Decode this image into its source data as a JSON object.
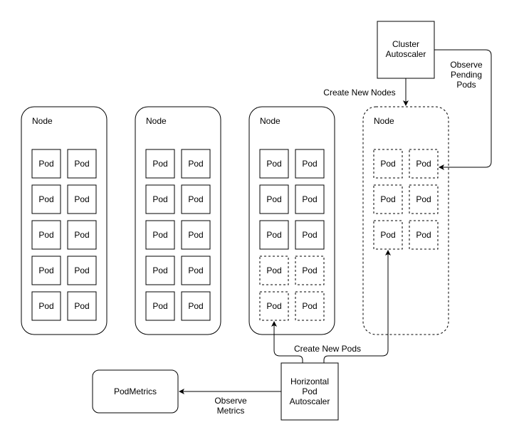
{
  "nodes": [
    {
      "label": "Node",
      "style": "solid",
      "pods": [
        {
          "label": "Pod",
          "style": "solid"
        },
        {
          "label": "Pod",
          "style": "solid"
        },
        {
          "label": "Pod",
          "style": "solid"
        },
        {
          "label": "Pod",
          "style": "solid"
        },
        {
          "label": "Pod",
          "style": "solid"
        },
        {
          "label": "Pod",
          "style": "solid"
        },
        {
          "label": "Pod",
          "style": "solid"
        },
        {
          "label": "Pod",
          "style": "solid"
        },
        {
          "label": "Pod",
          "style": "solid"
        },
        {
          "label": "Pod",
          "style": "solid"
        }
      ]
    },
    {
      "label": "Node",
      "style": "solid",
      "pods": [
        {
          "label": "Pod",
          "style": "solid"
        },
        {
          "label": "Pod",
          "style": "solid"
        },
        {
          "label": "Pod",
          "style": "solid"
        },
        {
          "label": "Pod",
          "style": "solid"
        },
        {
          "label": "Pod",
          "style": "solid"
        },
        {
          "label": "Pod",
          "style": "solid"
        },
        {
          "label": "Pod",
          "style": "solid"
        },
        {
          "label": "Pod",
          "style": "solid"
        },
        {
          "label": "Pod",
          "style": "solid"
        },
        {
          "label": "Pod",
          "style": "solid"
        }
      ]
    },
    {
      "label": "Node",
      "style": "solid",
      "pods": [
        {
          "label": "Pod",
          "style": "solid"
        },
        {
          "label": "Pod",
          "style": "solid"
        },
        {
          "label": "Pod",
          "style": "solid"
        },
        {
          "label": "Pod",
          "style": "solid"
        },
        {
          "label": "Pod",
          "style": "solid"
        },
        {
          "label": "Pod",
          "style": "solid"
        },
        {
          "label": "Pod",
          "style": "dashed"
        },
        {
          "label": "Pod",
          "style": "dashed"
        },
        {
          "label": "Pod",
          "style": "dashed"
        },
        {
          "label": "Pod",
          "style": "dashed"
        }
      ]
    },
    {
      "label": "Node",
      "style": "dashed",
      "pods": [
        {
          "label": "Pod",
          "style": "dashed"
        },
        {
          "label": "Pod",
          "style": "dashed"
        },
        {
          "label": "Pod",
          "style": "dashed"
        },
        {
          "label": "Pod",
          "style": "dashed"
        },
        {
          "label": "Pod",
          "style": "dashed"
        },
        {
          "label": "Pod",
          "style": "dashed"
        }
      ]
    }
  ],
  "cluster_autoscaler": {
    "lines": [
      "Cluster",
      "Autoscaler"
    ]
  },
  "hpa": {
    "lines": [
      "Horizontal",
      "Pod",
      "Autoscaler"
    ]
  },
  "pod_metrics": {
    "label": "PodMetrics"
  },
  "edges": {
    "create_new_nodes": "Create New Nodes",
    "observe_pending_pods": [
      "Observe",
      "Pending",
      "Pods"
    ],
    "create_new_pods": "Create New Pods",
    "observe_metrics": [
      "Observe",
      "Metrics"
    ]
  }
}
